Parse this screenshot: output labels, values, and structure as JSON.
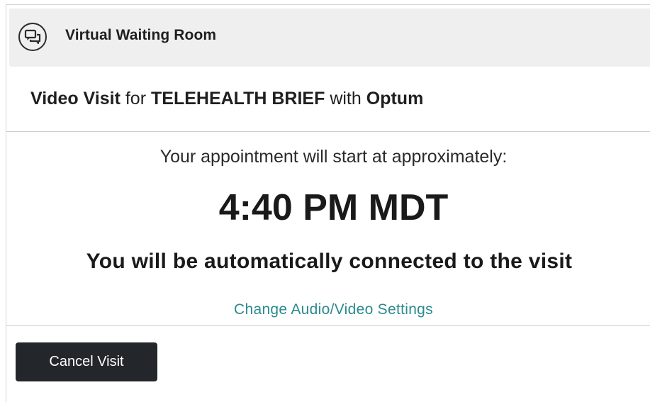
{
  "header": {
    "icon": "chat-bubbles-icon",
    "title": "Virtual Waiting Room"
  },
  "visit": {
    "type": "Video Visit",
    "for_word": "for",
    "name": "TELEHEALTH BRIEF",
    "with_word": "with",
    "provider": "Optum"
  },
  "appointment": {
    "approx_label": "Your appointment will start at approximately:",
    "time": "4:40 PM MDT",
    "auto_connect": "You will be automatically connected to the visit"
  },
  "settings_link": "Change Audio/Video Settings",
  "cancel_button": "Cancel Visit",
  "colors": {
    "link": "#2b8a8e",
    "button_bg": "#23272b",
    "header_bg": "#efefef"
  }
}
